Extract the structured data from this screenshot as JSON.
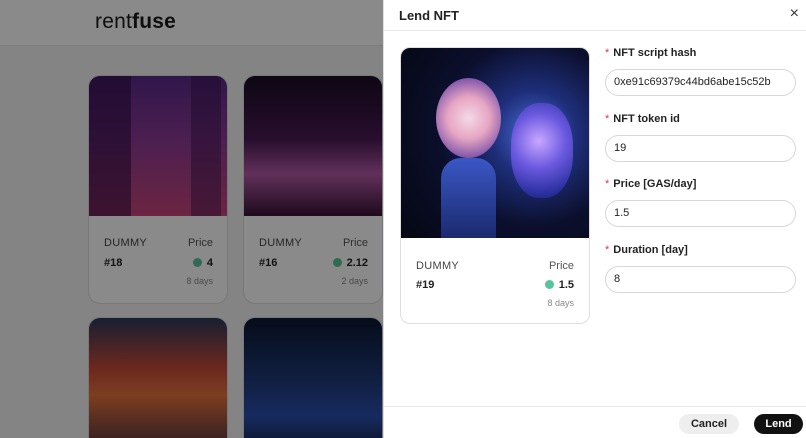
{
  "app": {
    "logo_light": "rent",
    "logo_bold": "fuse"
  },
  "cards": [
    {
      "collection": "DUMMY",
      "token": "#18",
      "price_label": "Price",
      "price": "4",
      "duration": "8 days"
    },
    {
      "collection": "DUMMY",
      "token": "#16",
      "price_label": "Price",
      "price": "2.12",
      "duration": "2 days"
    }
  ],
  "drawer": {
    "title": "Lend NFT",
    "close": "×",
    "preview": {
      "collection": "DUMMY",
      "token": "#19",
      "price_label": "Price",
      "price": "1.5",
      "duration": "8 days"
    },
    "fields": [
      {
        "label": "NFT script hash",
        "value": "0xe91c69379c44bd6abe15c52b"
      },
      {
        "label": "NFT token id",
        "value": "19"
      },
      {
        "label": "Price [GAS/day]",
        "value": "1.5"
      },
      {
        "label": "Duration [day]",
        "value": "8"
      }
    ],
    "required_mark": "*",
    "cancel_label": "Cancel",
    "lend_label": "Lend"
  },
  "colors": {
    "accent_green": "#55c59b",
    "required_red": "#e0364a",
    "primary_button": "#111111"
  },
  "icons": {
    "close": "close-icon",
    "gas": "gas-token-icon"
  }
}
